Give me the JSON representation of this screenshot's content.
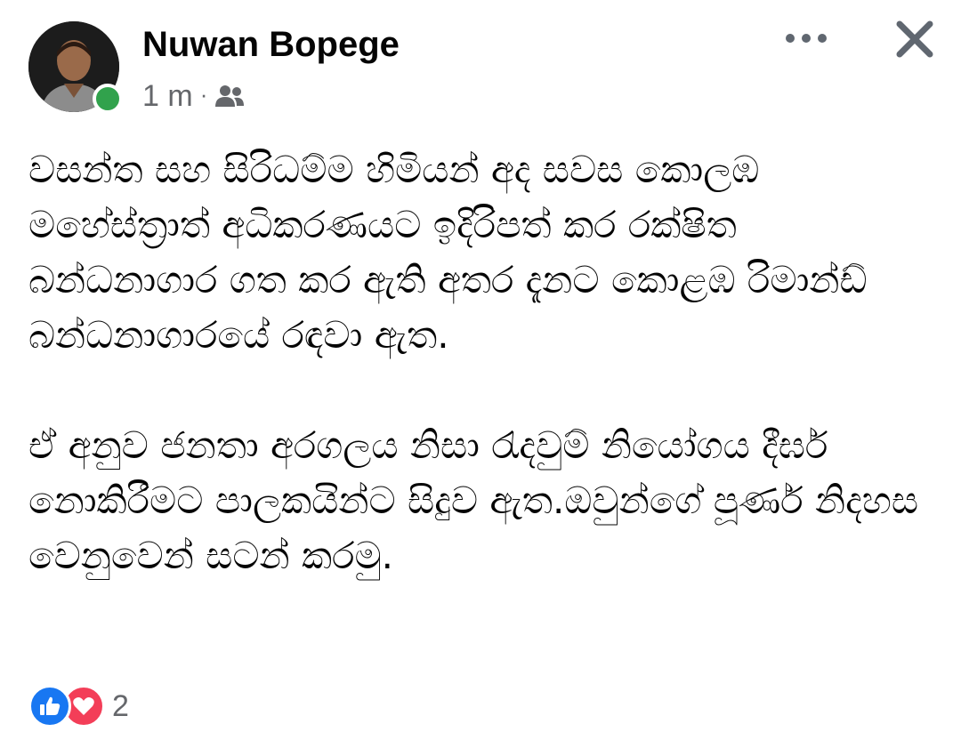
{
  "post": {
    "author": "Nuwan Bopege",
    "timestamp": "1 m",
    "separator": "·",
    "audience_icon": "friends-icon",
    "paragraphs": [
      "වසන්ත සහ සිරිධම්ම හිමියන් අද සවස කොලඹ මහේස්ත්‍රාත් අධිකරණයට ඉදිරිපත් කර රක්ෂිත බන්ධනාගාර ගත කර ඇති අතර දැනට කොළඹ රිමාන්ඩ් බන්ධනාගාරයේ රඳවා ඇත.",
      "ඒ අනුව ජනතා අරගලය නිසා රැදවුම් නියෝගය දීර්ඝ නොකිරීමට පාලකයින්ට සිදුව ඇත.ඔවුන්ගේ පූර්ණ නිදහස වෙනුවෙන් සටන් කරමු."
    ]
  },
  "reactions": {
    "types": [
      "like-icon",
      "love-icon"
    ],
    "count": "2"
  },
  "icons": {
    "more": "more-options-icon",
    "close": "close-icon"
  },
  "colors": {
    "like": "#1877f2",
    "love": "#f33e58",
    "online": "#31a24c",
    "secondary_text": "#65676b"
  }
}
